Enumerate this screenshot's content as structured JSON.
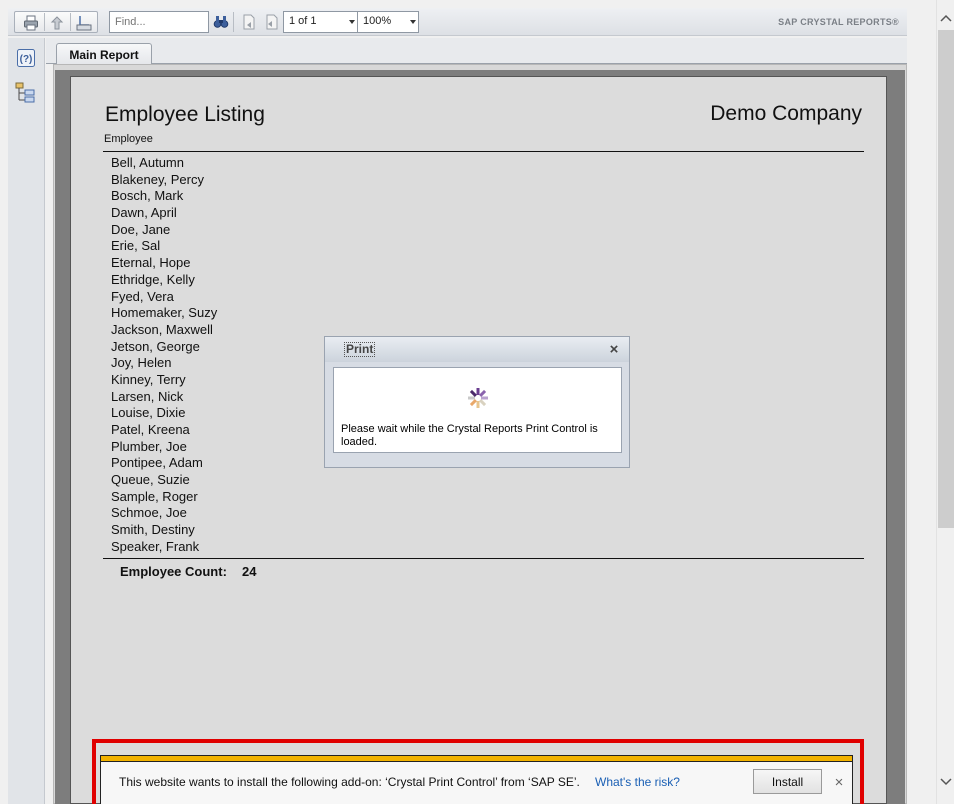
{
  "toolbar": {
    "find_placeholder": "Find...",
    "page_indicator": "1 of 1",
    "zoom": "100%",
    "brand": "SAP CRYSTAL REPORTS®",
    "icons": [
      "print-icon",
      "export-icon",
      "group-tree-icon",
      "binoculars-icon",
      "first-page-icon",
      "previous-page-icon"
    ]
  },
  "left_panel": {
    "icons": [
      "help-icon",
      "group-tree-icon"
    ]
  },
  "tabs": [
    {
      "label": "Main Report"
    }
  ],
  "report": {
    "title": "Employee Listing",
    "company": "Demo Company",
    "column_header": "Employee",
    "employees": [
      "Bell, Autumn",
      "Blakeney, Percy",
      "Bosch, Mark",
      "Dawn, April",
      "Doe, Jane",
      "Erie, Sal",
      "Eternal, Hope",
      "Ethridge, Kelly",
      "Fyed, Vera",
      "Homemaker, Suzy",
      "Jackson, Maxwell",
      "Jetson, George",
      "Joy, Helen",
      "Kinney, Terry",
      "Larsen, Nick",
      "Louise, Dixie",
      "Patel, Kreena",
      "Plumber, Joe",
      "Pontipee, Adam",
      "Queue, Suzie",
      "Sample, Roger",
      "Schmoe, Joe",
      "Smith, Destiny",
      "Speaker, Frank"
    ],
    "count_label": "Employee Count:",
    "count_value": "24"
  },
  "print_dialog": {
    "title": "Print",
    "message": "Please wait while the Crystal Reports Print Control is loaded."
  },
  "notification": {
    "message": "This website wants to install the following add-on: ‘Crystal Print Control’ from ‘SAP SE’.",
    "risk_link": "What's the risk?",
    "install_label": "Install",
    "accent_color": "#f2b200",
    "highlight_color": "#e00000"
  }
}
